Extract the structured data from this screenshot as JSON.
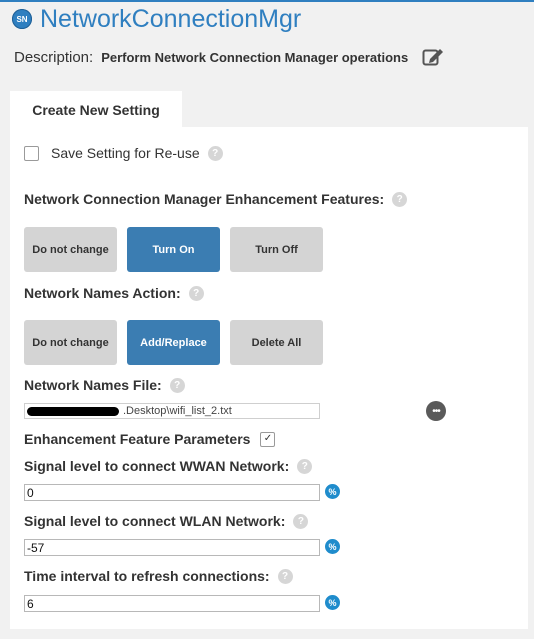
{
  "header": {
    "badge": "SN",
    "title": "NetworkConnectionMgr"
  },
  "description": {
    "label": "Description:",
    "value": "Perform Network Connection Manager operations"
  },
  "tab": {
    "label": "Create New Setting"
  },
  "save_setting": {
    "label": "Save Setting for Re-use",
    "checked": false
  },
  "enhancement_features": {
    "label": "Network Connection Manager Enhancement Features:",
    "options": [
      "Do not change",
      "Turn On",
      "Turn Off"
    ],
    "selected": "Turn On"
  },
  "network_names_action": {
    "label": "Network Names Action:",
    "options": [
      "Do not change",
      "Add/Replace",
      "Delete All"
    ],
    "selected": "Add/Replace"
  },
  "network_names_file": {
    "label": "Network Names File:",
    "value": ".Desktop\\wifi_list_2.txt"
  },
  "enhancement_params": {
    "label": "Enhancement Feature Parameters",
    "checked": true
  },
  "wwan_signal": {
    "label": "Signal level to connect WWAN Network:",
    "value": "0"
  },
  "wlan_signal": {
    "label": "Signal level to connect WLAN Network:",
    "value": "-57"
  },
  "refresh_interval": {
    "label": "Time interval to refresh connections:",
    "value": "6"
  },
  "icons": {
    "help": "?",
    "percent": "%",
    "more": "•••",
    "check": "✓"
  },
  "colors": {
    "accent": "#2f7fc0",
    "selected_button": "#3b7db2",
    "unselected_button": "#d4d4d4"
  }
}
